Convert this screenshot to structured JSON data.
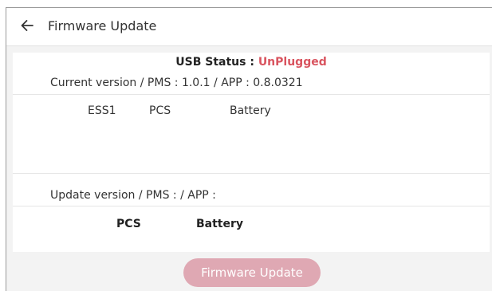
{
  "header": {
    "title": "Firmware Update",
    "back_icon": "arrow-left-icon"
  },
  "usb": {
    "label": "USB Status : ",
    "value": "UnPlugged",
    "value_color": "#d9545f"
  },
  "current_version": {
    "text": "Current version / PMS : 1.0.1 / APP : 0.8.0321",
    "columns": [
      "ESS1",
      "PCS",
      "Battery"
    ]
  },
  "update_version": {
    "text": "Update version / PMS :  / APP :",
    "columns": [
      "PCS",
      "Battery"
    ]
  },
  "action": {
    "button_label": "Firmware Update",
    "button_color": "#dfa8b3"
  }
}
